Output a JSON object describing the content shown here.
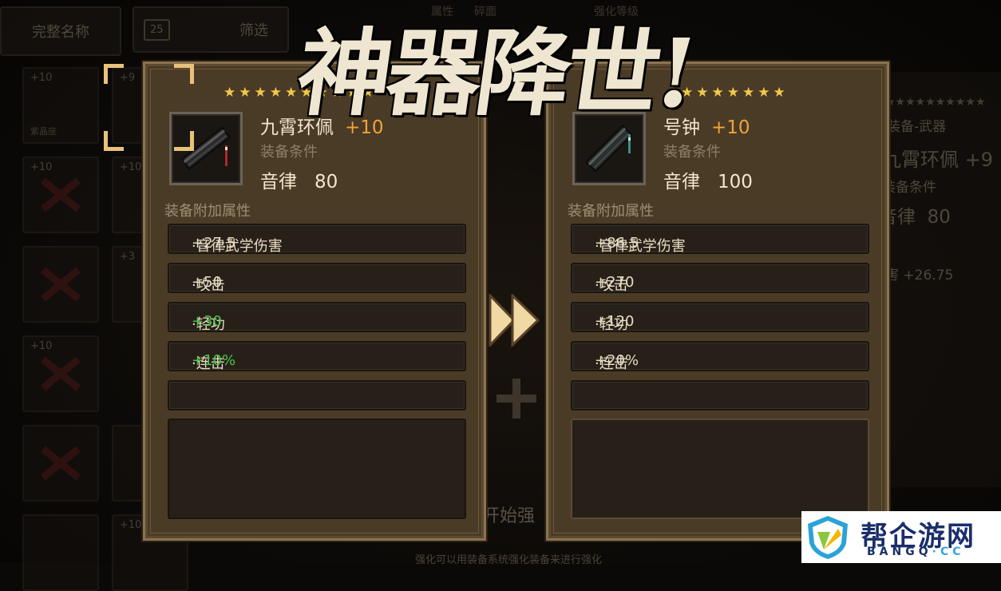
{
  "background": {
    "top_buttons": [
      "完整名称",
      "筛选"
    ],
    "top_badge": "25",
    "slot_levels": [
      "+10",
      "+9",
      "+10",
      "+10",
      "+3",
      "+10",
      "+10"
    ],
    "slot_caption": "紫晶座",
    "bottom_hint": "强化可以用装备系统强化装备来进行强化",
    "start_label": "开始强",
    "top_text": [
      "属性",
      "碎面",
      "强化等级"
    ],
    "right_panel": {
      "category": "装备-武器",
      "name": "九霄环佩",
      "plus": "+9",
      "cond": "装备条件",
      "stat": "音律",
      "value": "80",
      "dmg": "害 +26.75"
    }
  },
  "title": "神器降世!",
  "left_card": {
    "star_count": 10,
    "name": "九霄环佩",
    "plus": "+10",
    "cond_label": "装备条件",
    "req_stat": "音律",
    "req_value": "80",
    "attr_title": "装备附加属性",
    "attrs": [
      {
        "label": "·音律武学伤害",
        "value": "+27.5",
        "green": false
      },
      {
        "label": "·攻击",
        "value": "+50",
        "green": false
      },
      {
        "label": "·轻功",
        "value": "+30",
        "green": true
      },
      {
        "label": "·连击",
        "value": "+10%",
        "green": true
      }
    ]
  },
  "right_card": {
    "star_count": 7,
    "name": "号钟",
    "plus": "+10",
    "cond_label": "装备条件",
    "req_stat": "音律",
    "req_value": "100",
    "attr_title": "装备附加属性",
    "attrs": [
      {
        "label": "·音律武学伤害",
        "value": "+86.5",
        "green": false
      },
      {
        "label": "·攻击",
        "value": "+270",
        "green": false
      },
      {
        "label": "·轻功",
        "value": "+120",
        "green": false
      },
      {
        "label": "·连击",
        "value": "+20%",
        "green": false
      }
    ]
  },
  "watermark": {
    "main": "帮企游网",
    "sub_left": "BANGQ",
    "sub_dot": "·",
    "sub_right": "CC"
  },
  "colors": {
    "star": "#f0c94a",
    "plus": "#f0a43a",
    "green_value": "#4ec24b",
    "card_bg": "#4a3b26"
  }
}
